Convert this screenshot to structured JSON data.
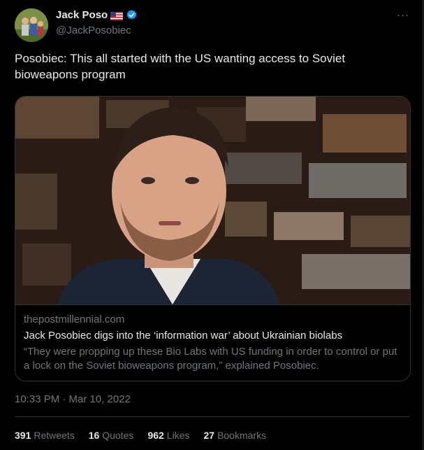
{
  "author": {
    "name": "Jack Poso",
    "handle": "@JackPosobiec",
    "flag_icon": "us-flag-icon",
    "verified_icon": "verified-badge-icon",
    "verified_color": "#1d9bf0"
  },
  "more_icon": "···",
  "tweet": {
    "text": "Posobiec: This all started with the US wanting access to Soviet bioweapons program"
  },
  "card": {
    "domain": "thepostmillennial.com",
    "title": "Jack Posobiec digs into the ‘information war’ about Ukrainian biolabs",
    "description": "“They were propping up these Bio Labs with US funding in order to control or put a lock on the Soviet bioweapons program,” explained Posobiec."
  },
  "timestamp": "10:33 PM · Mar 10, 2022",
  "stats": [
    {
      "count": "391",
      "label": "Retweets"
    },
    {
      "count": "16",
      "label": "Quotes"
    },
    {
      "count": "962",
      "label": "Likes"
    },
    {
      "count": "27",
      "label": "Bookmarks"
    }
  ],
  "colors": {
    "background": "#000000",
    "text": "#e7e9ea",
    "secondary": "#71767b",
    "border": "#2f3336"
  }
}
